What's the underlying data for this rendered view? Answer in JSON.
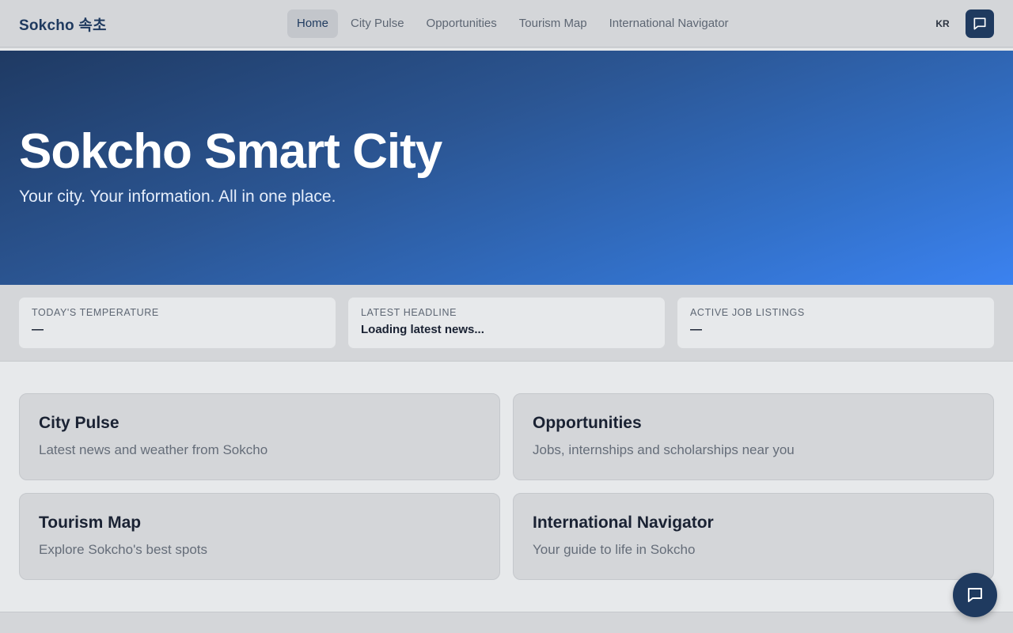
{
  "header": {
    "brand": "Sokcho 속초",
    "nav": [
      "Home",
      "City Pulse",
      "Opportunities",
      "Tourism Map",
      "International Navigator"
    ],
    "active_nav": "Home",
    "lang_toggle": "KR",
    "chat_icon": "chat-bubble-icon"
  },
  "hero": {
    "title": "Sokcho Smart City",
    "subtitle": "Your city. Your information. All in one place."
  },
  "stats": [
    {
      "label": "Today's Temperature",
      "value": "—"
    },
    {
      "label": "Latest Headline",
      "value": "Loading latest news..."
    },
    {
      "label": "Active Job Listings",
      "value": "—"
    }
  ],
  "cards": [
    {
      "title": "City Pulse",
      "desc": "Latest news and weather from Sokcho"
    },
    {
      "title": "Opportunities",
      "desc": "Jobs, internships and scholarships near you"
    },
    {
      "title": "Tourism Map",
      "desc": "Explore Sokcho's best spots"
    },
    {
      "title": "International Navigator",
      "desc": "Your guide to life in Sokcho"
    }
  ],
  "colors": {
    "brand": "#1f3a5f",
    "hero_start": "#1f3a63",
    "hero_end": "#3b82f0"
  }
}
